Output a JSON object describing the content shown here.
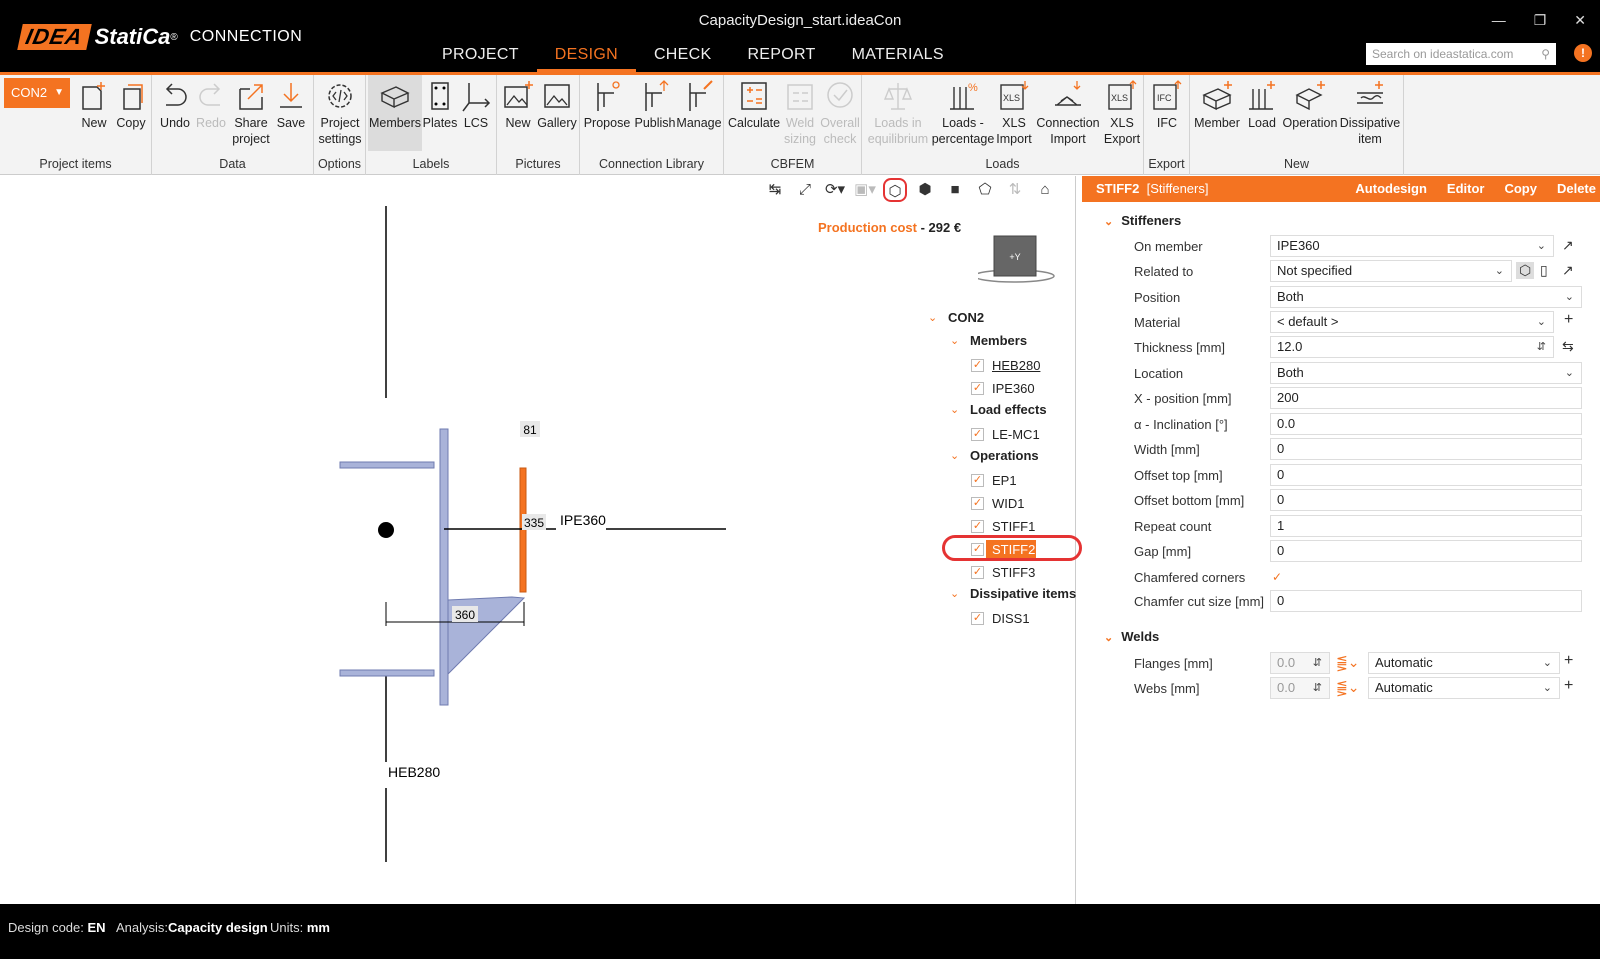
{
  "app": {
    "window_title": "CapacityDesign_start.ideaCon",
    "logo_idea": "IDEA",
    "logo_statica": "StatiCa",
    "logo_reg": "®",
    "product": "CONNECTION",
    "search_placeholder": "Search on ideastatica.com",
    "help": "!"
  },
  "menu": {
    "tabs": [
      "PROJECT",
      "DESIGN",
      "CHECK",
      "REPORT",
      "MATERIALS"
    ],
    "active": "DESIGN"
  },
  "ribbon": {
    "connection_selector": "CON2",
    "groups": {
      "project_items": "Project items",
      "data": "Data",
      "options": "Options",
      "labels": "Labels",
      "pictures": "Pictures",
      "connection_library": "Connection Library",
      "cbfem": "CBFEM",
      "loads": "Loads",
      "export": "Export",
      "new": "New"
    },
    "buttons": {
      "new": "New",
      "copy": "Copy",
      "undo": "Undo",
      "redo": "Redo",
      "share1": "Share",
      "share2": "project",
      "save": "Save",
      "psettings1": "Project",
      "psettings2": "settings",
      "members": "Members",
      "plates": "Plates",
      "lcs": "LCS",
      "pic_new": "New",
      "gallery": "Gallery",
      "propose": "Propose",
      "publish": "Publish",
      "manage": "Manage",
      "calculate": "Calculate",
      "weld1": "Weld",
      "weld2": "sizing",
      "overall1": "Overall",
      "overall2": "check",
      "loadseq1": "Loads in",
      "loadseq2": "equilibrium",
      "loadspct1": "Loads -",
      "loadspct2": "percentage",
      "xlsimp1": "XLS",
      "xlsimp2": "Import",
      "connimp1": "Connection",
      "connimp2": "Import",
      "xlsexp1": "XLS",
      "xlsexp2": "Export",
      "ifc": "IFC",
      "member": "Member",
      "load": "Load",
      "operation": "Operation",
      "diss1": "Dissipative",
      "diss2": "item"
    }
  },
  "canvas": {
    "production_cost_label": "Production cost",
    "production_cost_sep": " - ",
    "production_cost_value": "292 €",
    "viewcube_label": "+Y",
    "dims": {
      "d81": "81",
      "d335": "335",
      "d360": "360"
    },
    "member_labels": {
      "ipe": "IPE360",
      "heb": "HEB280"
    }
  },
  "tree": {
    "root": "CON2",
    "members_header": "Members",
    "members": [
      "HEB280",
      "IPE360"
    ],
    "load_effects_header": "Load effects",
    "load_effects": [
      "LE-MC1"
    ],
    "operations_header": "Operations",
    "operations": [
      "EP1",
      "WID1",
      "STIFF1",
      "STIFF2",
      "STIFF3"
    ],
    "selected_operation": "STIFF2",
    "dissipative_header": "Dissipative items",
    "dissipative": [
      "DISS1"
    ],
    "check": "✓"
  },
  "properties": {
    "header_name": "STIFF2",
    "header_type": "[Stiffeners]",
    "actions": [
      "Autodesign",
      "Editor",
      "Copy",
      "Delete"
    ],
    "stiffeners_section": "Stiffeners",
    "fields": [
      {
        "label": "On member",
        "value": "IPE360"
      },
      {
        "label": "Related to",
        "value": "Not specified"
      },
      {
        "label": "Position",
        "value": "Both"
      },
      {
        "label": "Material",
        "value": "< default >"
      },
      {
        "label": "Thickness [mm]",
        "value": "12.0"
      },
      {
        "label": "Location",
        "value": "Both"
      },
      {
        "label": "X - position [mm]",
        "value": "200"
      },
      {
        "label": "α - Inclination [°]",
        "value": "0.0"
      },
      {
        "label": "Width [mm]",
        "value": "0"
      },
      {
        "label": "Offset top [mm]",
        "value": "0"
      },
      {
        "label": "Offset bottom [mm]",
        "value": "0"
      },
      {
        "label": "Repeat count",
        "value": "1"
      },
      {
        "label": "Gap [mm]",
        "value": "0"
      },
      {
        "label": "Chamfered corners",
        "value": "✓"
      },
      {
        "label": "Chamfer cut size [mm]",
        "value": "0"
      }
    ],
    "welds_section": "Welds",
    "welds": [
      {
        "label": "Flanges [mm]",
        "size": "0.0",
        "type": "Automatic"
      },
      {
        "label": "Webs [mm]",
        "size": "0.0",
        "type": "Automatic"
      }
    ]
  },
  "status": {
    "design_code_label": "Design code:",
    "design_code": "EN",
    "analysis_label": "Analysis:",
    "analysis": "Capacity design",
    "units_label": "Units:",
    "units": "mm"
  },
  "colors": {
    "accent": "#f47321",
    "highlight_ring": "#e53333",
    "member_fill": "#a9b3d9",
    "member_stroke": "#6f7bb0"
  }
}
